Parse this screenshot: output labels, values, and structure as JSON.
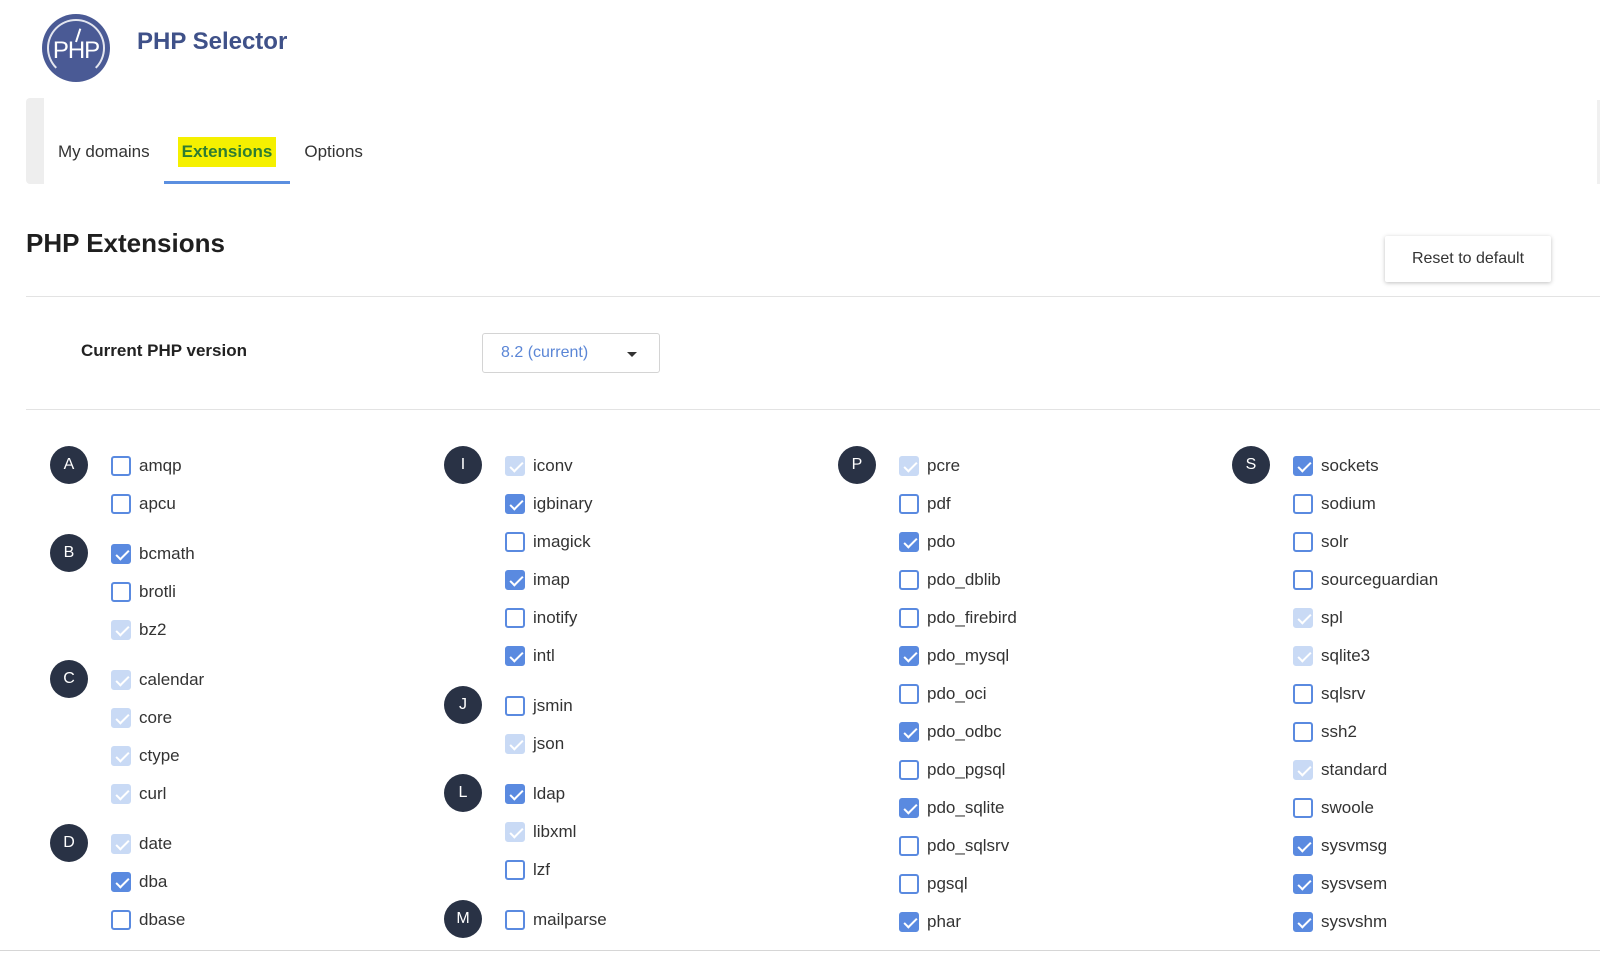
{
  "app": {
    "title": "PHP Selector",
    "logo_text": "PHP"
  },
  "tabs": [
    {
      "label": "My domains",
      "active": false
    },
    {
      "label": "Extensions",
      "active": true
    },
    {
      "label": "Options",
      "active": false
    }
  ],
  "section": {
    "title": "PHP Extensions",
    "reset_label": "Reset to default"
  },
  "version": {
    "label": "Current PHP version",
    "value": "8.2 (current)"
  },
  "colors": {
    "accent": "#5a8ae0",
    "brand": "#4a5a95",
    "default_checked": "#c9daf5",
    "badge": "#293245",
    "tab_highlight": "#f5f000"
  },
  "extension_columns": [
    {
      "groups": [
        {
          "letter": "A",
          "items": [
            {
              "name": "amqp",
              "state": "unchecked"
            },
            {
              "name": "apcu",
              "state": "unchecked"
            }
          ]
        },
        {
          "letter": "B",
          "items": [
            {
              "name": "bcmath",
              "state": "checked"
            },
            {
              "name": "brotli",
              "state": "unchecked"
            },
            {
              "name": "bz2",
              "state": "default"
            }
          ]
        },
        {
          "letter": "C",
          "items": [
            {
              "name": "calendar",
              "state": "default"
            },
            {
              "name": "core",
              "state": "default"
            },
            {
              "name": "ctype",
              "state": "default"
            },
            {
              "name": "curl",
              "state": "default"
            }
          ]
        },
        {
          "letter": "D",
          "items": [
            {
              "name": "date",
              "state": "default"
            },
            {
              "name": "dba",
              "state": "checked"
            },
            {
              "name": "dbase",
              "state": "unchecked"
            }
          ]
        }
      ]
    },
    {
      "groups": [
        {
          "letter": "I",
          "items": [
            {
              "name": "iconv",
              "state": "default"
            },
            {
              "name": "igbinary",
              "state": "checked"
            },
            {
              "name": "imagick",
              "state": "unchecked"
            },
            {
              "name": "imap",
              "state": "checked"
            },
            {
              "name": "inotify",
              "state": "unchecked"
            },
            {
              "name": "intl",
              "state": "checked"
            }
          ]
        },
        {
          "letter": "J",
          "items": [
            {
              "name": "jsmin",
              "state": "unchecked"
            },
            {
              "name": "json",
              "state": "default"
            }
          ]
        },
        {
          "letter": "L",
          "items": [
            {
              "name": "ldap",
              "state": "checked"
            },
            {
              "name": "libxml",
              "state": "default"
            },
            {
              "name": "lzf",
              "state": "unchecked"
            }
          ]
        },
        {
          "letter": "M",
          "items": [
            {
              "name": "mailparse",
              "state": "unchecked"
            }
          ]
        }
      ]
    },
    {
      "groups": [
        {
          "letter": "P",
          "items": [
            {
              "name": "pcre",
              "state": "default"
            },
            {
              "name": "pdf",
              "state": "unchecked"
            },
            {
              "name": "pdo",
              "state": "checked"
            },
            {
              "name": "pdo_dblib",
              "state": "unchecked"
            },
            {
              "name": "pdo_firebird",
              "state": "unchecked"
            },
            {
              "name": "pdo_mysql",
              "state": "checked"
            },
            {
              "name": "pdo_oci",
              "state": "unchecked"
            },
            {
              "name": "pdo_odbc",
              "state": "checked"
            },
            {
              "name": "pdo_pgsql",
              "state": "unchecked"
            },
            {
              "name": "pdo_sqlite",
              "state": "checked"
            },
            {
              "name": "pdo_sqlsrv",
              "state": "unchecked"
            },
            {
              "name": "pgsql",
              "state": "unchecked"
            },
            {
              "name": "phar",
              "state": "checked"
            }
          ]
        }
      ]
    },
    {
      "groups": [
        {
          "letter": "S",
          "items": [
            {
              "name": "sockets",
              "state": "checked"
            },
            {
              "name": "sodium",
              "state": "unchecked"
            },
            {
              "name": "solr",
              "state": "unchecked"
            },
            {
              "name": "sourceguardian",
              "state": "unchecked"
            },
            {
              "name": "spl",
              "state": "default"
            },
            {
              "name": "sqlite3",
              "state": "default"
            },
            {
              "name": "sqlsrv",
              "state": "unchecked"
            },
            {
              "name": "ssh2",
              "state": "unchecked"
            },
            {
              "name": "standard",
              "state": "default"
            },
            {
              "name": "swoole",
              "state": "unchecked"
            },
            {
              "name": "sysvmsg",
              "state": "checked"
            },
            {
              "name": "sysvsem",
              "state": "checked"
            },
            {
              "name": "sysvshm",
              "state": "checked"
            }
          ]
        }
      ]
    }
  ]
}
